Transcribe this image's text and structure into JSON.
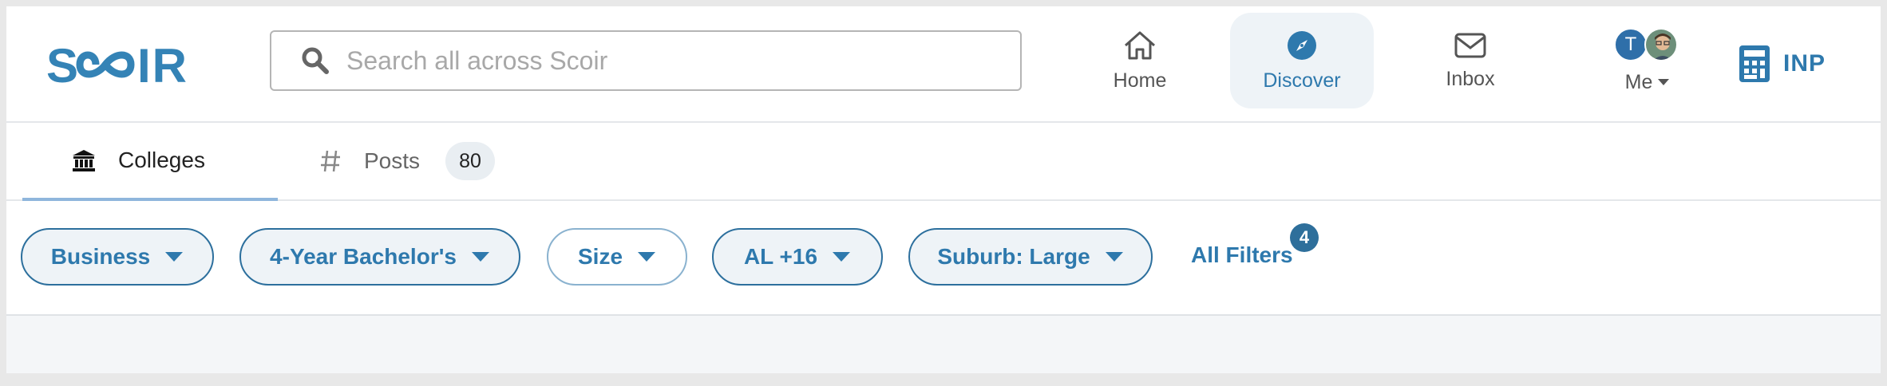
{
  "app": {
    "logo_text": "SCOIR",
    "brand_color": "#3483b6"
  },
  "search": {
    "placeholder": "Search all across Scoir",
    "value": ""
  },
  "nav": {
    "home": {
      "label": "Home",
      "icon": "home-icon"
    },
    "discover": {
      "label": "Discover",
      "icon": "compass-icon",
      "active": true
    },
    "inbox": {
      "label": "Inbox",
      "icon": "envelope-icon"
    },
    "me": {
      "label": "Me",
      "avatar_initial": "T"
    },
    "inp": {
      "label": "INP",
      "icon": "calculator-icon"
    }
  },
  "tabs": {
    "colleges": {
      "label": "Colleges",
      "icon": "institution-icon",
      "active": true
    },
    "posts": {
      "label": "Posts",
      "icon": "hashtag-icon",
      "count": "80"
    }
  },
  "filters": {
    "items": [
      {
        "label": "Business"
      },
      {
        "label": "4-Year Bachelor's"
      },
      {
        "label": "Size"
      },
      {
        "label": "AL +16"
      },
      {
        "label": "Suburb: Large"
      }
    ],
    "all_filters_label": "All Filters",
    "all_filters_count": "4"
  }
}
